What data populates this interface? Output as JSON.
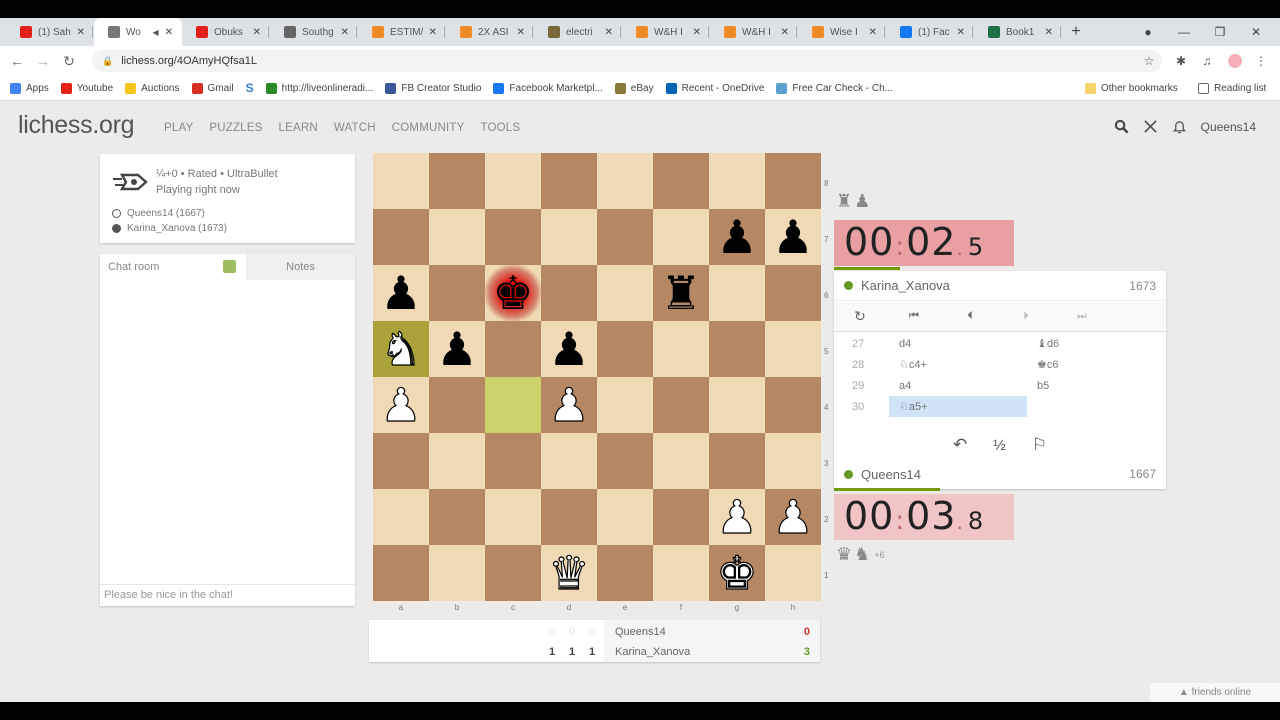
{
  "browser": {
    "tabs": [
      {
        "label": "(1) Sah",
        "icon_color": "#e62117",
        "active": false
      },
      {
        "label": "Wo",
        "icon_color": "#777777",
        "active": true,
        "audio": true
      },
      {
        "label": "Obuks",
        "icon_color": "#e62117",
        "active": false
      },
      {
        "label": "Southg",
        "icon_color": "#666666",
        "active": false
      },
      {
        "label": "ESTIM/",
        "icon_color": "#f08a24",
        "active": false
      },
      {
        "label": "2X ASI",
        "icon_color": "#f08a24",
        "active": false
      },
      {
        "label": "electri",
        "icon_color": "#7a6a3a",
        "active": false
      },
      {
        "label": "W&H I",
        "icon_color": "#f08a24",
        "active": false
      },
      {
        "label": "W&H I",
        "icon_color": "#f08a24",
        "active": false
      },
      {
        "label": "Wise I",
        "icon_color": "#f08a24",
        "active": false
      },
      {
        "label": "(1) Fac",
        "icon_color": "#1877f2",
        "active": false
      },
      {
        "label": "Book1",
        "icon_color": "#1e7145",
        "active": false
      }
    ],
    "new_tab": "+",
    "url": "lichess.org/4OAmyHQfsa1L",
    "bookmarks": [
      {
        "label": "Apps",
        "icon_color": "#4285f4"
      },
      {
        "label": "Youtube",
        "icon_color": "#e62117"
      },
      {
        "label": "Auctions",
        "icon_color": "#f5c518"
      },
      {
        "label": "Gmail",
        "icon_color": "#d93025"
      },
      {
        "label": "",
        "icon_color": "#3a7bd5",
        "glyph": "S"
      },
      {
        "label": "http://liveonlineradi...",
        "icon_color": "#2a8a2a"
      },
      {
        "label": "FB Creator Studio",
        "icon_color": "#3b5998"
      },
      {
        "label": "Facebook Marketpl...",
        "icon_color": "#1877f2"
      },
      {
        "label": "eBay",
        "icon_color": "#8a7a3a"
      },
      {
        "label": "Recent - OneDrive",
        "icon_color": "#0364b8"
      },
      {
        "label": "Free Car Check - Ch...",
        "icon_color": "#5aa0d0"
      }
    ],
    "other_bookmarks": "Other bookmarks",
    "reading_list": "Reading list"
  },
  "site": {
    "logo": "lichess.org",
    "nav": [
      "PLAY",
      "PUZZLES",
      "LEARN",
      "WATCH",
      "COMMUNITY",
      "TOOLS"
    ],
    "username": "Queens14"
  },
  "game_info": {
    "line1": "¼+0 • Rated • UltraBullet",
    "line2": "Playing right now",
    "white_player": "Queens14 (1667)",
    "black_player": "Karina_Xanova (1673)"
  },
  "chat": {
    "tab_chat": "Chat room",
    "tab_notes": "Notes",
    "placeholder": "Please be nice in the chat!"
  },
  "board": {
    "files": [
      "a",
      "b",
      "c",
      "d",
      "e",
      "f",
      "g",
      "h"
    ],
    "ranks": [
      "8",
      "7",
      "6",
      "5",
      "4",
      "3",
      "2",
      "1"
    ],
    "position": [
      [
        "",
        "",
        "",
        "",
        "",
        "",
        "",
        ""
      ],
      [
        "",
        "",
        "",
        "",
        "",
        "",
        "p",
        "p"
      ],
      [
        "p",
        "",
        "k",
        "",
        "",
        "r",
        "",
        ""
      ],
      [
        "N",
        "p",
        "",
        "p",
        "",
        "",
        "",
        ""
      ],
      [
        "P",
        "",
        "",
        "P",
        "",
        "",
        "",
        ""
      ],
      [
        "",
        "",
        "",
        "",
        "",
        "",
        "",
        ""
      ],
      [
        "",
        "",
        "",
        "",
        "",
        "",
        "P",
        "P"
      ],
      [
        "",
        "",
        "",
        "Q",
        "",
        "",
        "K",
        ""
      ]
    ],
    "last_move": [
      "c4",
      "a5"
    ],
    "check_square": "c6"
  },
  "crosstable": {
    "rows": [
      {
        "name": "Queens14",
        "results": [
          "0",
          "0",
          "0"
        ],
        "score": "0",
        "score_color": "#cc3333"
      },
      {
        "name": "Karina_Xanova",
        "results": [
          "1",
          "1",
          "1"
        ],
        "score": "3",
        "score_color": "#629924"
      }
    ]
  },
  "opponent": {
    "name": "Karina_Xanova",
    "rating": "1673",
    "clock_main": "00",
    "clock_sec": "02",
    "clock_tenths": "5",
    "material": [
      "♜",
      "♟"
    ],
    "time_fraction": 0.2
  },
  "player": {
    "name": "Queens14",
    "rating": "1667",
    "clock_main": "00",
    "clock_sec": "03",
    "clock_tenths": "8",
    "material": [
      "♛",
      "♞"
    ],
    "material_diff": "+6",
    "time_fraction": 0.32
  },
  "moves": [
    {
      "num": "27",
      "white": "d4",
      "black": "♝d6"
    },
    {
      "num": "28",
      "white": "♘c4+",
      "black": "♚c6"
    },
    {
      "num": "29",
      "white": "a4",
      "black": "b5"
    },
    {
      "num": "30",
      "white": "♘a5+",
      "black": ""
    }
  ],
  "active_move": "30w",
  "controls": {
    "flip": "↻",
    "first": "⏮",
    "prev": "⏴",
    "next": "⏵",
    "last": "⏭"
  },
  "actions": {
    "takeback": "↶",
    "draw": "½",
    "resign": "⚐"
  },
  "footer": {
    "friends": "▲ friends online"
  },
  "colors": {
    "accent_green": "#629924",
    "clock_opponent_bg": "#e8a0a3",
    "clock_player_bg": "#f1c4c6",
    "board_light": "#f0d9b5",
    "board_dark": "#b58863"
  }
}
